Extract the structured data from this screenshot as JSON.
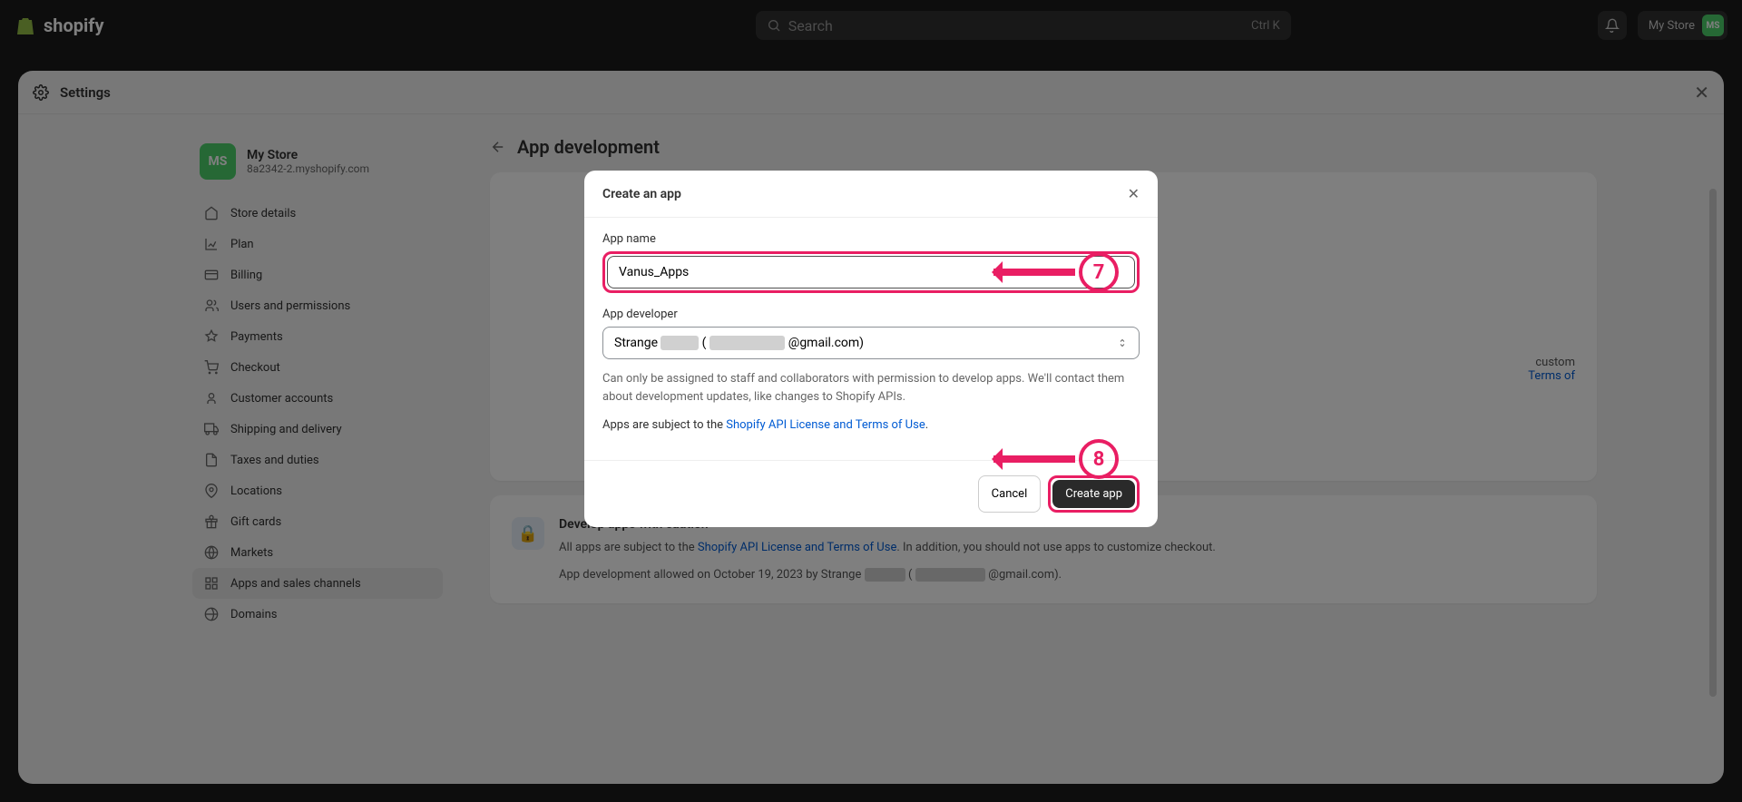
{
  "topbar": {
    "logo_text": "shopify",
    "search_placeholder": "Search",
    "search_kbd": "Ctrl K",
    "store_name": "My Store",
    "avatar_initials": "MS"
  },
  "settings": {
    "title": "Settings",
    "store": {
      "avatar": "MS",
      "name": "My Store",
      "url": "8a2342-2.myshopify.com"
    },
    "nav": [
      {
        "label": "Store details",
        "icon": "store"
      },
      {
        "label": "Plan",
        "icon": "plan"
      },
      {
        "label": "Billing",
        "icon": "billing"
      },
      {
        "label": "Users and permissions",
        "icon": "users"
      },
      {
        "label": "Payments",
        "icon": "payments"
      },
      {
        "label": "Checkout",
        "icon": "checkout"
      },
      {
        "label": "Customer accounts",
        "icon": "accounts"
      },
      {
        "label": "Shipping and delivery",
        "icon": "shipping"
      },
      {
        "label": "Taxes and duties",
        "icon": "taxes"
      },
      {
        "label": "Locations",
        "icon": "locations"
      },
      {
        "label": "Gift cards",
        "icon": "gift"
      },
      {
        "label": "Markets",
        "icon": "markets"
      },
      {
        "label": "Apps and sales channels",
        "icon": "apps",
        "active": true
      },
      {
        "label": "Domains",
        "icon": "domains"
      }
    ]
  },
  "main": {
    "title": "App development",
    "top_card": {
      "hidden_text_fragment": "custom",
      "terms_link": "Terms of"
    },
    "caution": {
      "title": "Develop apps with caution",
      "text_prefix": "All apps are subject to the ",
      "link": "Shopify API License and Terms of Use",
      "text_suffix": ". In addition, you should not use apps to customize checkout.",
      "footer_prefix": "App development allowed on October 19, 2023 by Strange",
      "footer_suffix": "@gmail.com)."
    }
  },
  "modal": {
    "title": "Create an app",
    "app_name_label": "App name",
    "app_name_value": "Vanus_Apps",
    "developer_label": "App developer",
    "developer_value_prefix": "Strange",
    "developer_value_suffix": "@gmail.com)",
    "help_text": "Can only be assigned to staff and collaborators with permission to develop apps. We'll contact them about development updates, like changes to Shopify APIs.",
    "subject_prefix": "Apps are subject to the ",
    "subject_link": "Shopify API License and Terms of Use",
    "subject_suffix": ".",
    "cancel": "Cancel",
    "create": "Create app"
  },
  "annotations": {
    "seven": "7",
    "eight": "8"
  }
}
